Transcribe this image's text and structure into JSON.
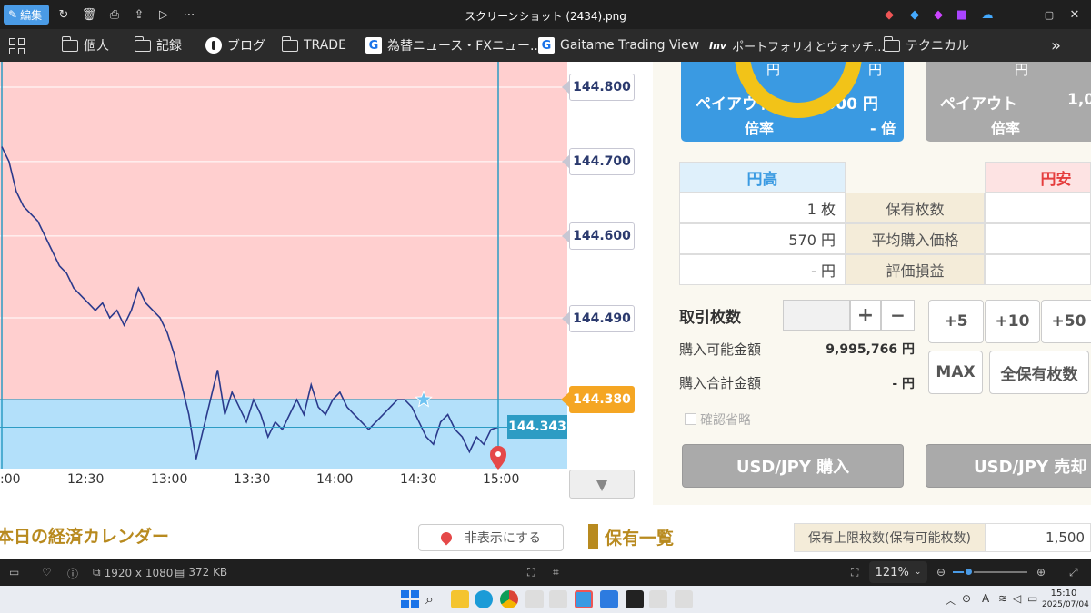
{
  "window": {
    "edit_label": "編集",
    "title": "スクリーンショット (2434).png",
    "min": "–",
    "max": "▢",
    "close": "✕"
  },
  "bookmarks": {
    "items": [
      {
        "label": "個人",
        "icon": "folder-icon"
      },
      {
        "label": "記録",
        "icon": "folder-icon"
      },
      {
        "label": "ブログ",
        "icon": "blog-icon"
      },
      {
        "label": "TRADE",
        "icon": "folder-icon"
      },
      {
        "label": "為替ニュース・FXニュー...",
        "icon": "gaitame-icon"
      },
      {
        "label": "Gaitame Trading View",
        "icon": "gaitame-icon"
      },
      {
        "label": "ポートフォリオとウォッチ...",
        "icon": "investing-icon"
      },
      {
        "label": "テクニカル",
        "icon": "folder-icon"
      }
    ],
    "more": "»",
    "inv_label": "Inv"
  },
  "chart_data": {
    "type": "line",
    "x_ticks": [
      ":00",
      "12:30",
      "13:00",
      "13:30",
      "14:00",
      "14:30",
      "15:00"
    ],
    "y_ticks": [
      "144.800",
      "144.700",
      "144.600",
      "144.490"
    ],
    "strike": "144.380",
    "current": "144.343",
    "series": [
      {
        "values": [
          144.72,
          144.7,
          144.66,
          144.64,
          144.63,
          144.62,
          144.6,
          144.58,
          144.56,
          144.55,
          144.53,
          144.52,
          144.51,
          144.5,
          144.51,
          144.49,
          144.5,
          144.48,
          144.5,
          144.53,
          144.51,
          144.5,
          144.49,
          144.47,
          144.44,
          144.4,
          144.36,
          144.3,
          144.34,
          144.38,
          144.42,
          144.36,
          144.39,
          144.37,
          144.35,
          144.38,
          144.36,
          144.33,
          144.35,
          144.34,
          144.36,
          144.38,
          144.36,
          144.4,
          144.37,
          144.36,
          144.38,
          144.39,
          144.37,
          144.36,
          144.35,
          144.34,
          144.35,
          144.36,
          144.37,
          144.38,
          144.38,
          144.37,
          144.35,
          144.33,
          144.32,
          144.35,
          144.36,
          144.34,
          144.33,
          144.31,
          144.33,
          144.32,
          144.34,
          144.343
        ]
      }
    ],
    "colors": {
      "above_strike": "#ffcfcf",
      "below_strike": "#b3e0fa",
      "line": "#2b3a8c",
      "strike": "#f5a623",
      "current": "#2d9cc4"
    }
  },
  "panel": {
    "payout_left": "ペイアウト",
    "payout_left_amount": ",000 円",
    "rate_left": "倍率",
    "rate_left_value": "- 倍",
    "yen_top_left": "円",
    "yen_top_right": "円",
    "payout_right": "ペイアウト",
    "payout_right_amount": "1,0",
    "rate_right": "倍率",
    "yen_top_right2": "円",
    "header_high": "円高",
    "header_low": "円安",
    "rows": [
      {
        "left": "1 枚",
        "label": "保有枚数"
      },
      {
        "left": "570 円",
        "label": "平均購入価格"
      },
      {
        "left": "- 円",
        "label": "評価損益"
      }
    ],
    "trade_qty_label": "取引枚数",
    "plus": "+",
    "minus": "−",
    "plus5": "+5",
    "plus10": "+10",
    "plus50": "+50",
    "available_label": "購入可能金額",
    "available_value": "9,995,766 円",
    "total_label": "購入合計金額",
    "total_value": "- 円",
    "max_label": "MAX",
    "all_label": "全保有枚数",
    "confirm_skip": "確認省略",
    "buy_label": "USD/JPY 購入",
    "sell_label": "USD/JPY 売却"
  },
  "bottom": {
    "calendar_title": "本日の経済カレンダー",
    "hide_label": "非表示にする",
    "holdings_title": "保有一覧",
    "limit_label": "保有上限枚数(保有可能枚数)",
    "limit_value": "1,500"
  },
  "status": {
    "resolution": "1920 x 1080",
    "size": "372 KB",
    "zoom": "121%"
  },
  "taskbar": {
    "time": "15:10",
    "date": "2025/07/04"
  }
}
